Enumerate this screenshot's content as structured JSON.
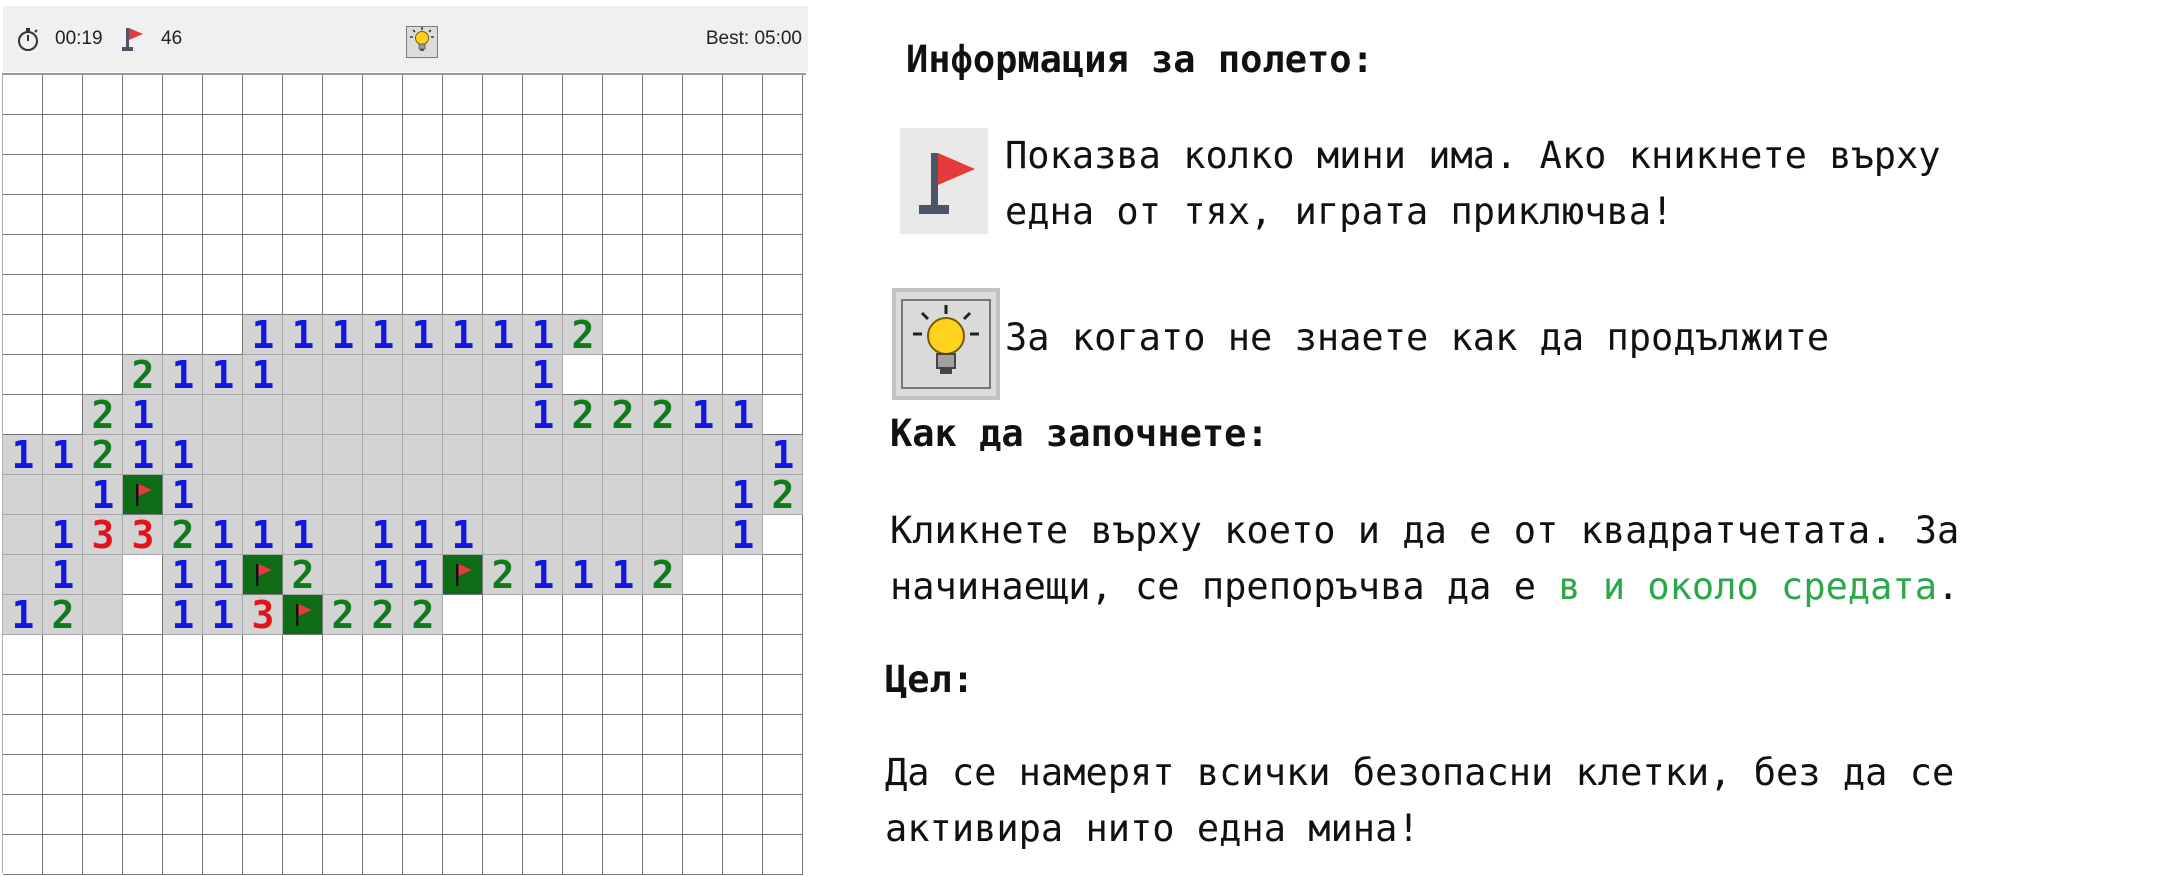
{
  "toolbar": {
    "timer": "00:19",
    "flag_count": "46",
    "best_label": "Best: 05:00",
    "icons": {
      "timer": "stopwatch-icon",
      "flag": "flag-icon",
      "hint": "lightbulb-icon"
    }
  },
  "board": {
    "cols": 20,
    "rows": 20,
    "legend": {
      "#": "unopened cell",
      ".": "opened empty cell",
      "F": "flagged cell",
      "1-3": "revealed number"
    },
    "cells": [
      "####################",
      "####################",
      "####################",
      "####################",
      "####################",
      "####################",
      "######111111112#####",
      "###2111......1######",
      "##21.........122211#",
      "11211..............1",
      "..1F1.............12",
      ".1332111.111......1#",
      ".1.#11F2.11F21112###",
      "12.#113F222#########",
      "####################",
      "####################",
      "####################",
      "####################",
      "####################",
      "####################"
    ],
    "number_colors": {
      "1": "#1515e0",
      "2": "#0f7a1e",
      "3": "#e0141a"
    },
    "flag_cell_color": "#0e6b16",
    "open_cell_color": "#d3d3d3"
  },
  "info": {
    "field_title": "Информация за полето:",
    "flag_description_line1": "Показва колко мини има. Ако кникнете върху",
    "flag_description_line2": "една от тях, играта приключва!",
    "hint_description": "За когато не знаете как да продължите",
    "start_title": "Как да започнете:",
    "start_line1": "Кликнете върху което и да е от квадратчетата. За",
    "start_line2_pre": "начинаещи, се препоръчва да е ",
    "start_line2_accent": "в и около средата",
    "start_line2_post": ".",
    "goal_title": "Цел:",
    "goal_line1": "Да се намерят всички безопасни клетки, без да се",
    "goal_line2": "активира нито една мина!",
    "accent_color": "#2ca84a",
    "icons": {
      "flag": "flag-icon",
      "hint": "lightbulb-icon"
    }
  }
}
